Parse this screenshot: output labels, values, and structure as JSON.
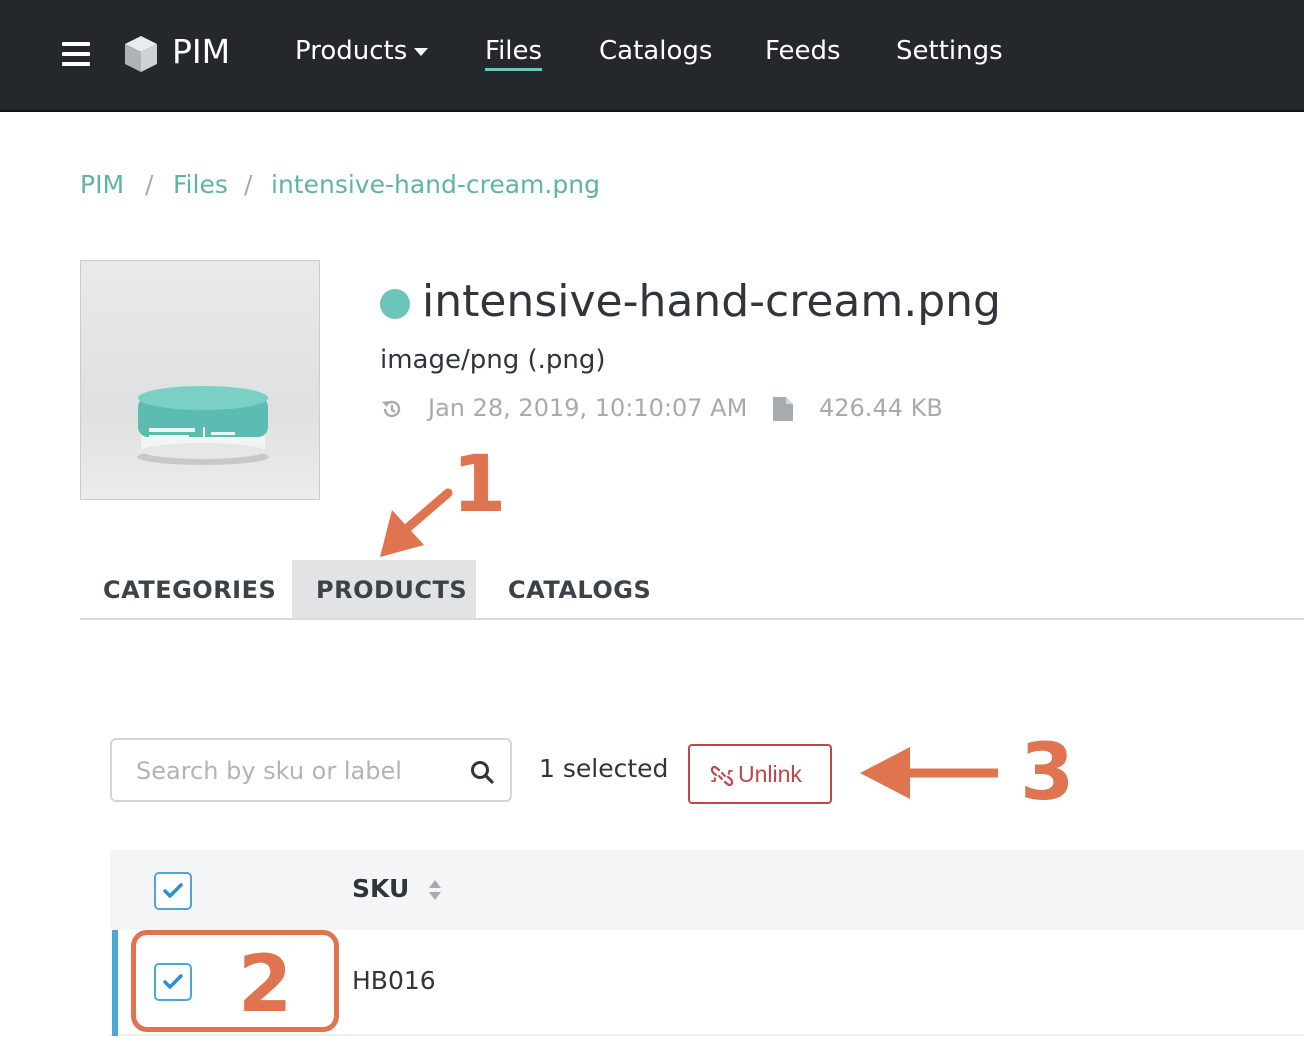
{
  "nav": {
    "brand": "PIM",
    "items": [
      {
        "label": "Products",
        "dropdown": true
      },
      {
        "label": "Files",
        "active": true
      },
      {
        "label": "Catalogs"
      },
      {
        "label": "Feeds"
      },
      {
        "label": "Settings"
      }
    ]
  },
  "breadcrumb": [
    "PIM",
    "Files",
    "intensive-hand-cream.png"
  ],
  "breadcrumb_sep": "/",
  "file": {
    "name": "intensive-hand-cream.png",
    "mime": "image/png (.png)",
    "modified": "Jan 28, 2019, 10:10:07 AM",
    "size": "426.44 KB",
    "status_color": "#6cc5ba",
    "thumbnail_label": "intensive hand cream"
  },
  "tabs": [
    {
      "label": "CATEGORIES"
    },
    {
      "label": "PRODUCTS",
      "active": true
    },
    {
      "label": "CATALOGS"
    }
  ],
  "toolbar": {
    "search_placeholder": "Search by sku or label",
    "selected_text": "1 selected",
    "unlink_label": "Unlink"
  },
  "table": {
    "columns": [
      "SKU"
    ],
    "rows": [
      {
        "sku": "HB016",
        "checked": true
      }
    ],
    "header_checked": true
  },
  "annotations": [
    "1",
    "2",
    "3"
  ],
  "colors": {
    "accent": "#6cc5ba",
    "danger": "#c0464c",
    "annotation": "#e07450",
    "checkbox": "#4aa8d8"
  }
}
